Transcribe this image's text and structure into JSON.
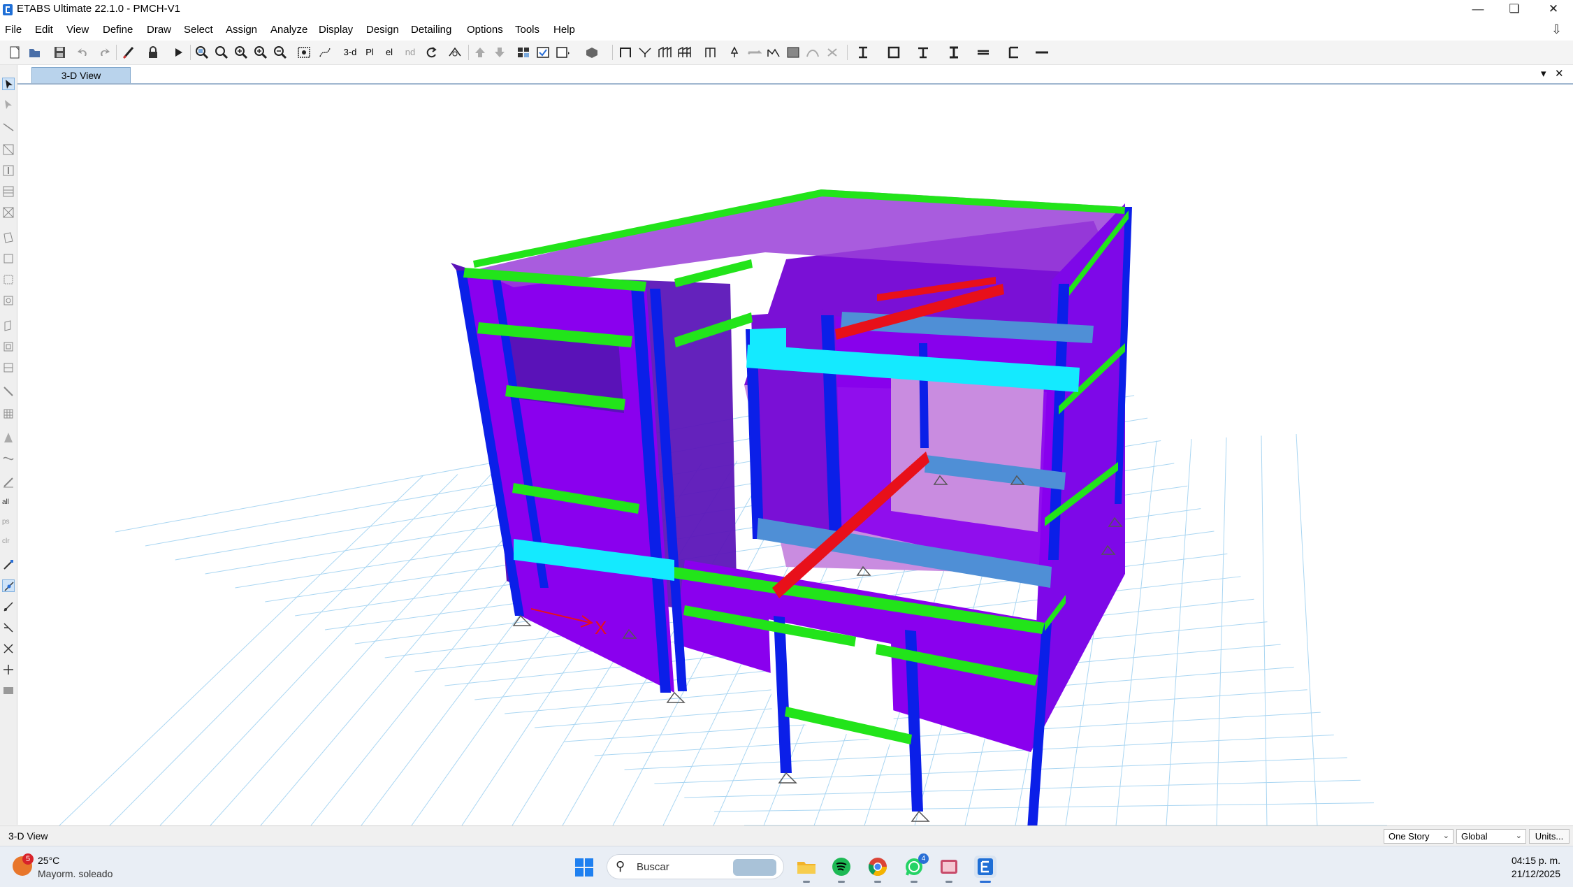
{
  "window": {
    "title": "ETABS Ultimate 22.1.0 - PMCH-V1"
  },
  "menu": [
    "File",
    "Edit",
    "View",
    "Define",
    "Draw",
    "Select",
    "Assign",
    "Analyze",
    "Display",
    "Design",
    "Detailing",
    "Options",
    "Tools",
    "Help"
  ],
  "toolbar": {
    "icons": [
      "new-model-icon",
      "open-icon",
      "save-icon",
      "undo-icon",
      "redo-icon",
      "refresh-icon",
      "lock-icon",
      "run-analysis-icon",
      "zoom-window-icon",
      "zoom-restore-icon",
      "zoom-in-icon",
      "zoom-out-icon",
      "pan-icon",
      "rubber-band-icon",
      "view-3d-icon",
      "plan-view-icon",
      "elevation-view-icon",
      "view-nd-icon",
      "rotate-3d-icon",
      "perspective-icon",
      "move-up-icon",
      "move-down-icon",
      "object-shrink-icon",
      "set-display-options-icon",
      "view-options-icon",
      "extrude-icon",
      "quick-draw-beam-icon",
      "quick-draw-brace-icon",
      "draw-wall-icon",
      "draw-wall-stack-icon",
      "draw-link-icon",
      "reshape-icon",
      "draw-frame-icon",
      "draw-column-icon",
      "draw-floor-icon",
      "snap-icon",
      "section-i-icon",
      "section-box-icon",
      "section-t-icon",
      "section-c-icon",
      "section-angle-icon",
      "section-double-icon",
      "section-flat-icon"
    ],
    "view_3d_label": "3-d",
    "plan_label": "Pl",
    "elev_label": "el",
    "nd_label": "nd"
  },
  "left_toolbar": {
    "icons": [
      "select-pointer-icon",
      "reshape-pointer-icon",
      "draw-beam-icon",
      "draw-brace-icon",
      "draw-column-icon",
      "draw-secondary-beam-icon",
      "draw-cross-brace-icon",
      "draw-floor-icon",
      "draw-rect-floor-icon",
      "draw-null-area-icon",
      "draw-opening-icon",
      "draw-wall-icon",
      "draw-wall-opening-icon",
      "draw-rect-wall-icon",
      "draw-link-icon",
      "draw-grid-icon",
      "draw-tendon-icon",
      "draw-dimension-icon",
      "draw-reference-line-icon",
      "select-all-icon",
      "previous-selection-icon",
      "clear-selection-icon",
      "snap-endpoints-icon",
      "snap-midpoint-icon",
      "snap-intersection-icon",
      "snap-perpendicular-icon",
      "snap-lines-icon",
      "snap-fine-grid-icon",
      "snap-extension-icon"
    ],
    "all_label": "all",
    "ps_label": "ps",
    "clr_label": "clr"
  },
  "tab": {
    "label": "3-D View"
  },
  "model": {
    "axis_label": "X",
    "colors": {
      "walls": "#8a00ee",
      "walls_dark": "#5a12b8",
      "columns": "#0b1fe8",
      "beams_green": "#22e41a",
      "beams_cyan": "#14eaff",
      "beams_blue": "#4f8fd6",
      "beams_red": "#e8101a",
      "slab": "#c98ce0",
      "grid": "#aad6f2"
    }
  },
  "status": {
    "view_label": "3-D View",
    "story_option": "One Story",
    "coord_option": "Global",
    "units_button": "Units..."
  },
  "taskbar": {
    "weather_badge": "5",
    "weather_temp": "25°C",
    "weather_desc": "Mayorm. soleado",
    "search_placeholder": "Buscar",
    "apps": [
      "file-explorer-icon",
      "spotify-icon",
      "chrome-icon",
      "whatsapp-icon",
      "snipping-tool-icon",
      "etabs-app-icon"
    ],
    "whatsapp_badge": "4",
    "time": "04:15 p. m.",
    "date": "21/12/2025"
  }
}
